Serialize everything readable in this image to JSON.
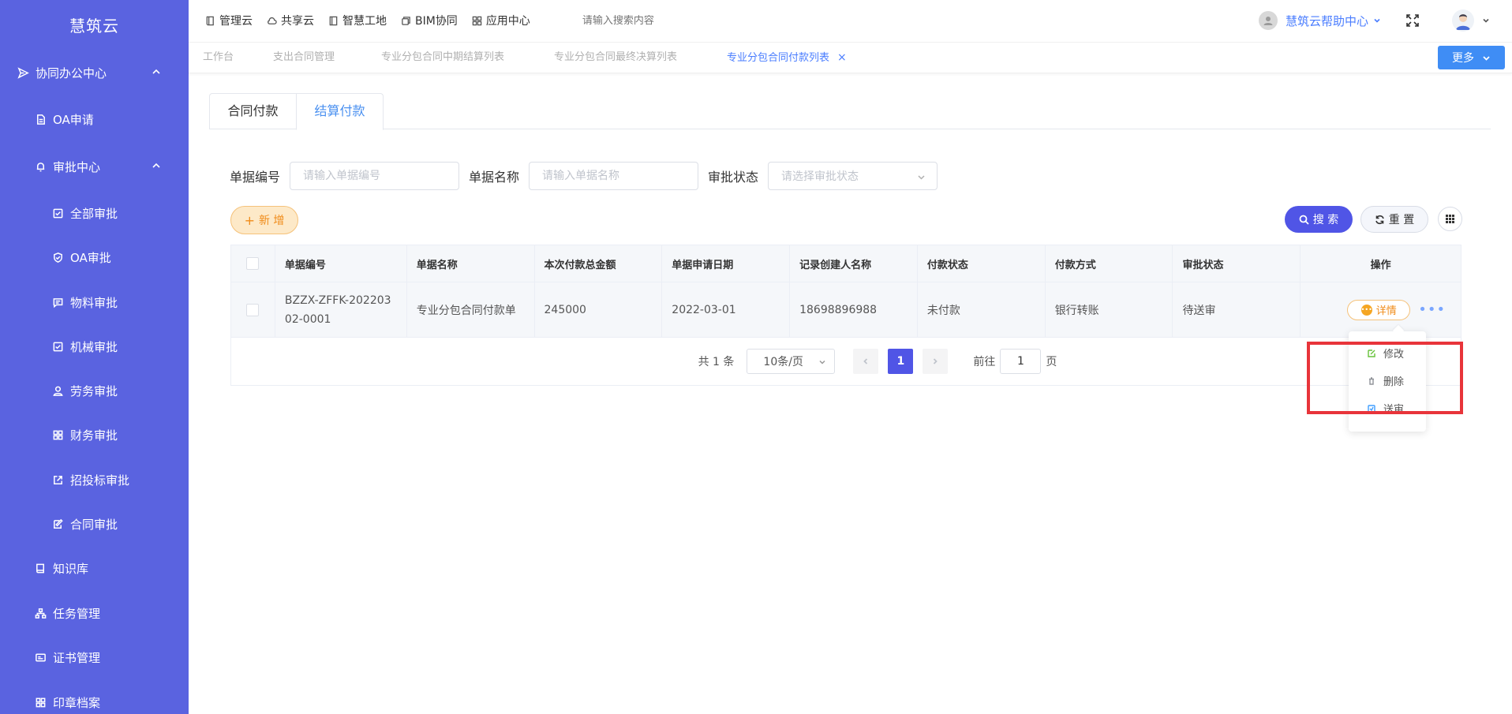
{
  "app": {
    "name": "慧筑云"
  },
  "sidebar": {
    "items": [
      {
        "label": "协同办公中心",
        "icon": "send-icon",
        "level": 0,
        "expanded": true
      },
      {
        "label": "OA申请",
        "icon": "document-icon",
        "level": 1
      },
      {
        "label": "审批中心",
        "icon": "bell-icon",
        "level": 1,
        "expanded": true
      },
      {
        "label": "全部审批",
        "icon": "checkbox-icon",
        "level": 2
      },
      {
        "label": "OA审批",
        "icon": "shield-icon",
        "level": 2
      },
      {
        "label": "物料审批",
        "icon": "message-icon",
        "level": 2
      },
      {
        "label": "机械审批",
        "icon": "checkbox-icon",
        "level": 2
      },
      {
        "label": "劳务审批",
        "icon": "person-icon",
        "level": 2
      },
      {
        "label": "财务审批",
        "icon": "grid-icon",
        "level": 2
      },
      {
        "label": "招投标审批",
        "icon": "share-icon",
        "level": 2
      },
      {
        "label": "合同审批",
        "icon": "edit-icon",
        "level": 2
      },
      {
        "label": "知识库",
        "icon": "book-icon",
        "level": 1
      },
      {
        "label": "任务管理",
        "icon": "hierarchy-icon",
        "level": 1
      },
      {
        "label": "证书管理",
        "icon": "card-icon",
        "level": 1
      },
      {
        "label": "印章档案",
        "icon": "grid-icon",
        "level": 1
      }
    ]
  },
  "topbar": {
    "nav": [
      {
        "label": "管理云",
        "icon": "book-icon"
      },
      {
        "label": "共享云",
        "icon": "cloud-icon"
      },
      {
        "label": "智慧工地",
        "icon": "document-icon"
      },
      {
        "label": "BIM协同",
        "icon": "cube-icon"
      },
      {
        "label": "应用中心",
        "icon": "grid-icon"
      }
    ],
    "search_placeholder": "请输入搜索内容",
    "help_label": "慧筑云帮助中心"
  },
  "visited_tabs": {
    "items": [
      {
        "label": "工作台"
      },
      {
        "label": "支出合同管理"
      },
      {
        "label": "专业分包合同中期结算列表"
      },
      {
        "label": "专业分包合同最终决算列表"
      },
      {
        "label": "专业分包合同付款列表",
        "active": true,
        "close": "×"
      }
    ],
    "more_label": "更多"
  },
  "inner_tabs": {
    "first": "合同付款",
    "second": "结算付款"
  },
  "filters": {
    "code_label": "单据编号",
    "code_placeholder": "请输入单据编号",
    "name_label": "单据名称",
    "name_placeholder": "请输入单据名称",
    "status_label": "审批状态",
    "status_placeholder": "请选择审批状态"
  },
  "actions": {
    "add": "新 增",
    "add_symbol": "+",
    "search": "搜 索",
    "reset": "重 置"
  },
  "table": {
    "headers": [
      "单据编号",
      "单据名称",
      "本次付款总金额",
      "单据申请日期",
      "记录创建人名称",
      "付款状态",
      "付款方式",
      "审批状态",
      "操作"
    ],
    "rows": [
      {
        "code": "BZZX-ZFFK-20220302-0001",
        "name": "专业分包合同付款单",
        "amount": "245000",
        "date": "2022-03-01",
        "creator": "18698896988",
        "pay_status": "未付款",
        "pay_method": "银行转账",
        "approval_status": "待送审",
        "detail_label": "详情",
        "more_label": "•••"
      }
    ]
  },
  "pagination": {
    "total_text": "共 1 条",
    "page_size": "10条/页",
    "current_page": "1",
    "goto_prefix": "前往",
    "goto_value": "1",
    "goto_suffix": "页"
  },
  "row_menu": {
    "items": [
      {
        "label": "修改",
        "icon": "edit-icon",
        "color": "#67c23a"
      },
      {
        "label": "删除",
        "icon": "trash-icon",
        "color": "#909399"
      },
      {
        "label": "送审",
        "icon": "send-doc-icon",
        "color": "#409eff"
      }
    ]
  },
  "colors": {
    "sidebar": "#5a63e0",
    "primary": "#5055e6",
    "link": "#4a7dff",
    "highlight": "#e8343a",
    "warning": "#f08c1a"
  }
}
